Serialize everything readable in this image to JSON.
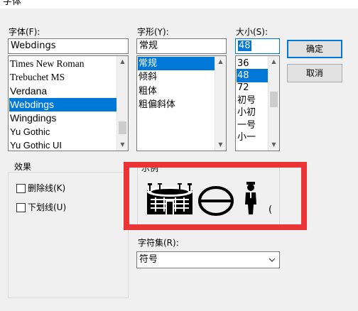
{
  "window": {
    "title": "字体"
  },
  "font": {
    "label": "字体(F):",
    "value": "Webdings",
    "items": [
      "Times New Roman",
      "Trebuchet MS",
      "Verdana",
      "Webdings",
      "Wingdings",
      "Yu Gothic",
      "Yu Gothic UI"
    ],
    "selected": "Webdings"
  },
  "style": {
    "label": "字形(Y):",
    "value": "常规",
    "items": [
      "常规",
      "倾斜",
      "粗体",
      "粗偏斜体"
    ],
    "selected": "常规"
  },
  "size": {
    "label": "大小(S):",
    "value": "48",
    "items": [
      "36",
      "48",
      "72",
      "初号",
      "小初",
      "一号",
      "小一"
    ],
    "selected": "48"
  },
  "buttons": {
    "ok": "确定",
    "cancel": "取消"
  },
  "effects": {
    "label": "效果",
    "strikeout": {
      "label": "删除线(K)",
      "checked": false
    },
    "underline": {
      "label": "下划线(U)",
      "checked": false
    }
  },
  "sample": {
    "label": "示例",
    "glyph_tail": "("
  },
  "script": {
    "label": "字符集(R):",
    "value": "符号"
  },
  "colors": {
    "accent": "#0078d7",
    "highlight_frame": "#ec3336"
  }
}
